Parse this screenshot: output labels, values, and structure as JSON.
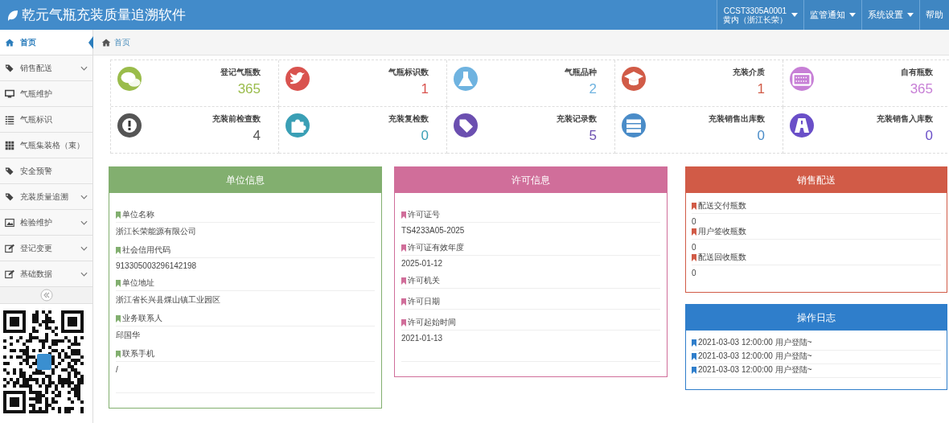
{
  "app": {
    "title": "乾元气瓶充装质量追溯软件"
  },
  "account": {
    "id": "CCST3305A0001",
    "name": "黄内（浙江长荣）"
  },
  "menus": [
    {
      "label": "监管通知",
      "dropdown": true
    },
    {
      "label": "系统设置",
      "dropdown": true
    },
    {
      "label": "帮助",
      "dropdown": false
    }
  ],
  "sidebar": {
    "items": [
      {
        "label": "首页",
        "selected": true,
        "expandable": false
      },
      {
        "label": "销售配送",
        "selected": false,
        "expandable": true
      },
      {
        "label": "气瓶维护",
        "selected": false,
        "expandable": false
      },
      {
        "label": "气瓶标识",
        "selected": false,
        "expandable": false
      },
      {
        "label": "气瓶集装格（束）",
        "selected": false,
        "expandable": false
      },
      {
        "label": "安全预警",
        "selected": false,
        "expandable": false
      },
      {
        "label": "充装质量追溯",
        "selected": false,
        "expandable": true
      },
      {
        "label": "检验维护",
        "selected": false,
        "expandable": true
      },
      {
        "label": "登记变更",
        "selected": false,
        "expandable": true
      },
      {
        "label": "基础数据",
        "selected": false,
        "expandable": true
      }
    ]
  },
  "breadcrumb": {
    "label": "首页"
  },
  "stats": [
    {
      "label": "登记气瓶数",
      "value": "365",
      "color": "#9abc4b"
    },
    {
      "label": "气瓶标识数",
      "value": "1",
      "color": "#d9534f"
    },
    {
      "label": "气瓶品种",
      "value": "2",
      "color": "#6fb3e0"
    },
    {
      "label": "充装介质",
      "value": "1",
      "color": "#d15b47"
    },
    {
      "label": "自有瓶数",
      "value": "365",
      "color": "#c77fd6"
    },
    {
      "label": "充装前检查数",
      "value": "4",
      "color": "#555555"
    },
    {
      "label": "充装复检数",
      "value": "0",
      "color": "#3a9fb5"
    },
    {
      "label": "充装记录数",
      "value": "5",
      "color": "#6b4fb0"
    },
    {
      "label": "充装销售出库数",
      "value": "0",
      "color": "#4a8cc8"
    },
    {
      "label": "充装销售入库数",
      "value": "0",
      "color": "#6a4fc8"
    }
  ],
  "panels": [
    {
      "kind": "fields",
      "title": "单位信息",
      "color": "#82af6f",
      "items": [
        {
          "label": "单位名称",
          "value": "浙江长荣能源有限公司"
        },
        {
          "label": "社会信用代码",
          "value": "913305003296142198"
        },
        {
          "label": "单位地址",
          "value": "浙江省长兴县煤山镇工业园区"
        },
        {
          "label": "业务联系人",
          "value": "邱国华"
        },
        {
          "label": "联系手机",
          "value": "/"
        }
      ]
    },
    {
      "kind": "fields",
      "title": "许可信息",
      "color": "#d06e9a",
      "items": [
        {
          "label": "许可证号",
          "value": "TS4233A05-2025"
        },
        {
          "label": "许可证有效年度",
          "value": "2025-01-12"
        },
        {
          "label": "许可机关"
        },
        {
          "label": "许可日期"
        },
        {
          "label": "许可起始时间",
          "value": "2021-01-13"
        }
      ]
    },
    {
      "kind": "counts",
      "title": "销售配送",
      "color": "#d15b47",
      "items": [
        {
          "label": "配送交付瓶数",
          "value": "0"
        },
        {
          "label": "用户签收瓶数",
          "value": "0"
        },
        {
          "label": "配送回收瓶数",
          "value": "0"
        }
      ]
    },
    {
      "kind": "log",
      "title": "操作日志",
      "color": "#2f7ecb",
      "items": [
        {
          "label": "2021-03-03 12:00:00 用户登陆~"
        },
        {
          "label": "2021-03-03 12:00:00 用户登陆~"
        },
        {
          "label": "2021-03-03 12:00:00 用户登陆~"
        }
      ]
    }
  ]
}
